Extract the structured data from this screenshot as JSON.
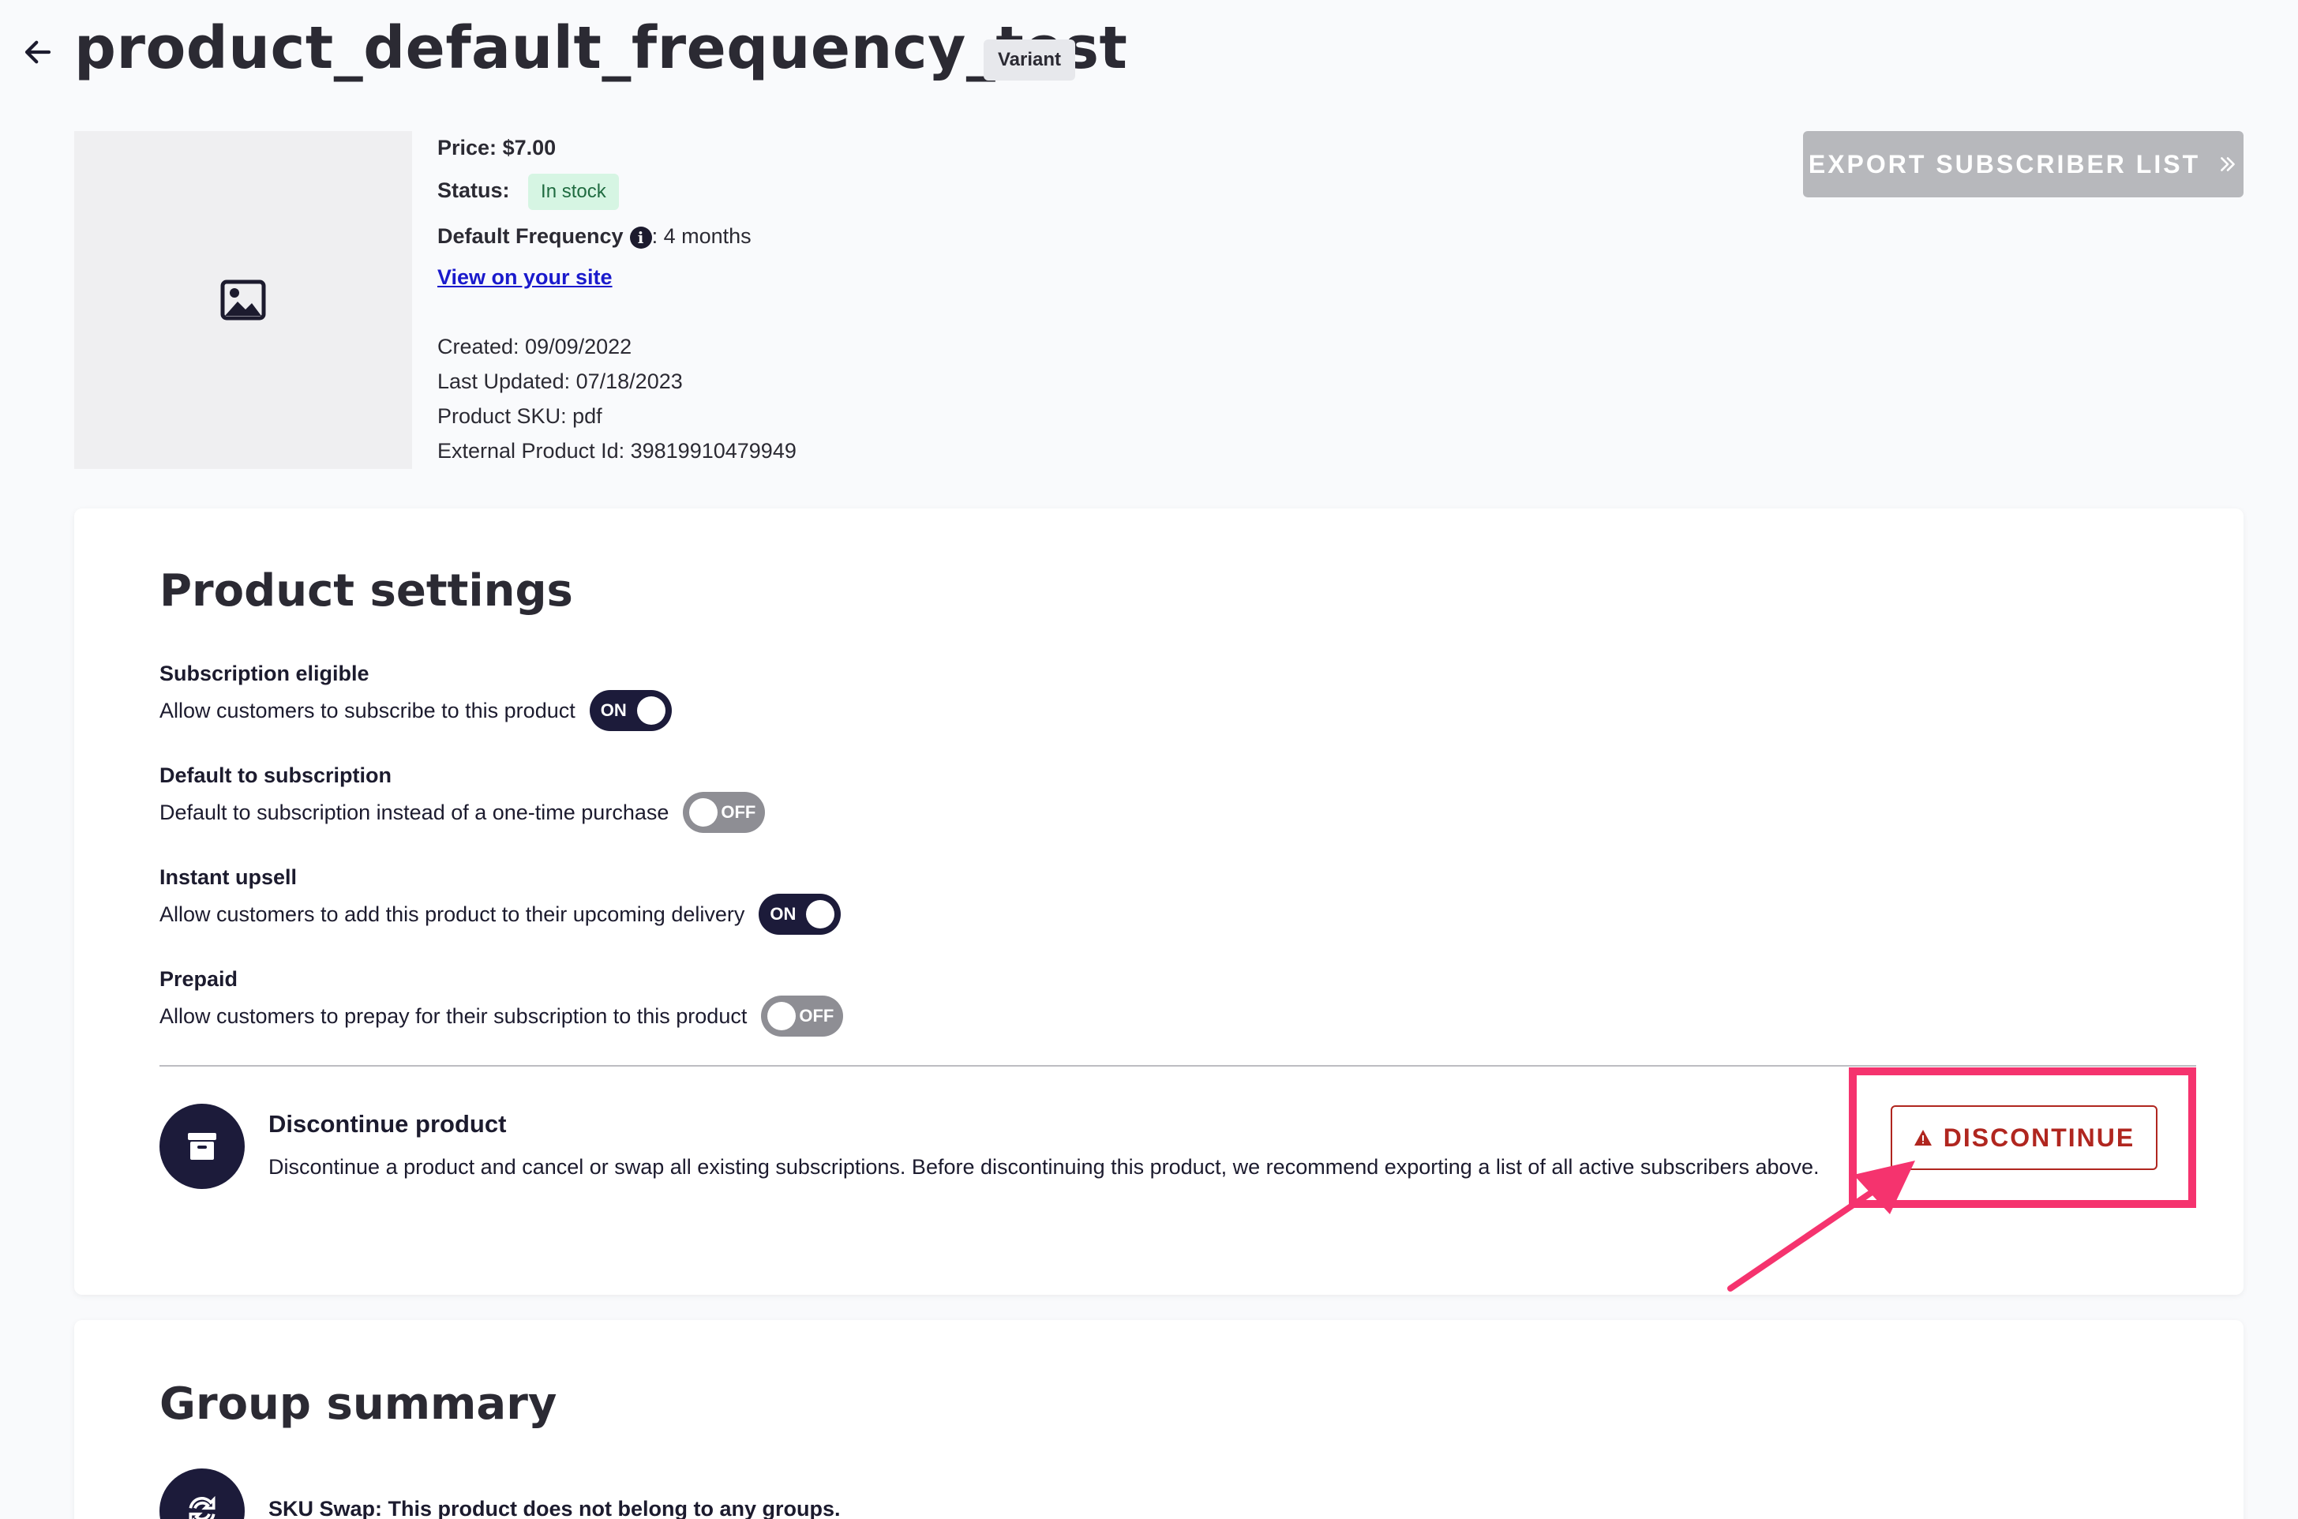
{
  "header": {
    "back_icon": "arrow-left-icon",
    "title": "product_default_frequency_test",
    "badge": "Variant"
  },
  "product": {
    "image_icon": "image-placeholder-icon",
    "price_label": "Price:",
    "price_value": "$7.00",
    "status_label": "Status:",
    "status_value": "In stock",
    "frequency_label": "Default Frequency",
    "frequency_info_icon": "info-icon",
    "frequency_value": ": 4 months",
    "view_link": "View on your site",
    "created": "Created: 09/09/2022",
    "last_updated": "Last Updated: 07/18/2023",
    "sku": "Product SKU: pdf",
    "external_id": "External Product Id: 39819910479949"
  },
  "export_button": {
    "label": "EXPORT SUBSCRIBER LIST",
    "icon": "double-chevron-right-icon"
  },
  "settings": {
    "title": "Product settings",
    "items": [
      {
        "title": "Subscription eligible",
        "desc": "Allow customers to subscribe to this product",
        "state": "ON"
      },
      {
        "title": "Default to subscription",
        "desc": "Default to subscription instead of a one-time purchase",
        "state": "OFF"
      },
      {
        "title": "Instant upsell",
        "desc": "Allow customers to add this product to their upcoming delivery",
        "state": "ON"
      },
      {
        "title": "Prepaid",
        "desc": "Allow customers to prepay for their subscription to this product",
        "state": "OFF"
      }
    ],
    "discontinue": {
      "icon": "archive-box-icon",
      "title": "Discontinue product",
      "desc": "Discontinue a product and cancel or swap all existing subscriptions. Before discontinuing this product, we recommend exporting a list of all active subscribers above.",
      "button_label": "DISCONTINUE",
      "button_icon": "warning-triangle-icon"
    }
  },
  "group_summary": {
    "title": "Group summary",
    "icon": "swap-arrows-icon",
    "text": "SKU Swap: This product does not belong to any groups."
  },
  "colors": {
    "dark": "#1c1b3a",
    "danger": "#b0261f",
    "annotation": "#f5336e",
    "success_bg": "#d6f5e3"
  }
}
